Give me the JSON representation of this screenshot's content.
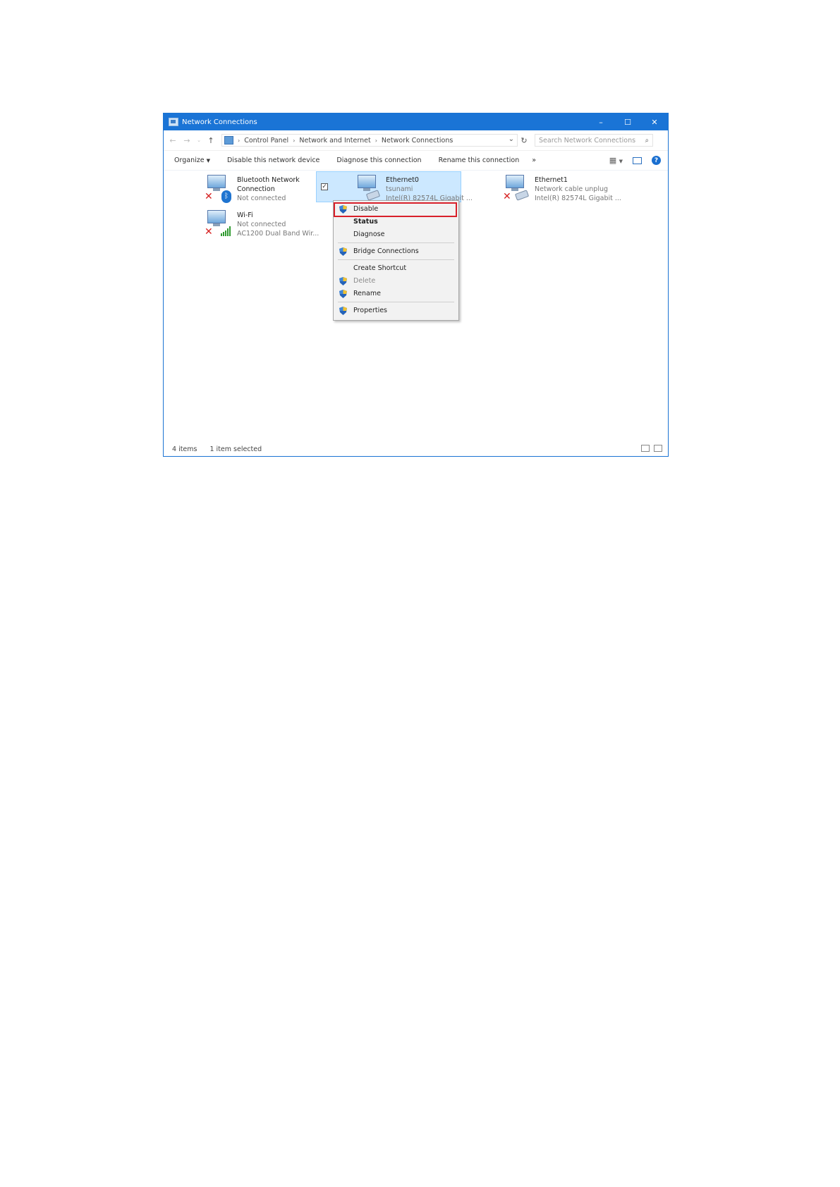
{
  "window": {
    "title": "Network Connections"
  },
  "address": {
    "crumbs": [
      "Control Panel",
      "Network and Internet",
      "Network Connections"
    ],
    "search_placeholder": "Search Network Connections"
  },
  "toolbar": {
    "organize": "Organize",
    "disable_device": "Disable this network device",
    "diagnose": "Diagnose this connection",
    "rename": "Rename this connection",
    "more": "»"
  },
  "connections": [
    {
      "name": "Bluetooth Network",
      "name2": "Connection",
      "status": "Not connected",
      "device": ""
    },
    {
      "name": "Ethernet0",
      "status": "tsunami",
      "device": "Intel(R) 82574L Gigabit ..."
    },
    {
      "name": "Ethernet1",
      "status": "Network cable unplug",
      "device": "Intel(R) 82574L Gigabit ..."
    },
    {
      "name": "Wi-Fi",
      "status": "Not connected",
      "device": "AC1200 Dual Band Wir..."
    }
  ],
  "context_menu": {
    "disable": "Disable",
    "status": "Status",
    "diagnose": "Diagnose",
    "bridge": "Bridge Connections",
    "shortcut": "Create Shortcut",
    "delete": "Delete",
    "rename": "Rename",
    "properties": "Properties"
  },
  "statusbar": {
    "items": "4 items",
    "selected": "1 item selected"
  },
  "colors": {
    "accent": "#1a74d6",
    "selection": "#cce8ff",
    "highlight": "#d8202a"
  }
}
